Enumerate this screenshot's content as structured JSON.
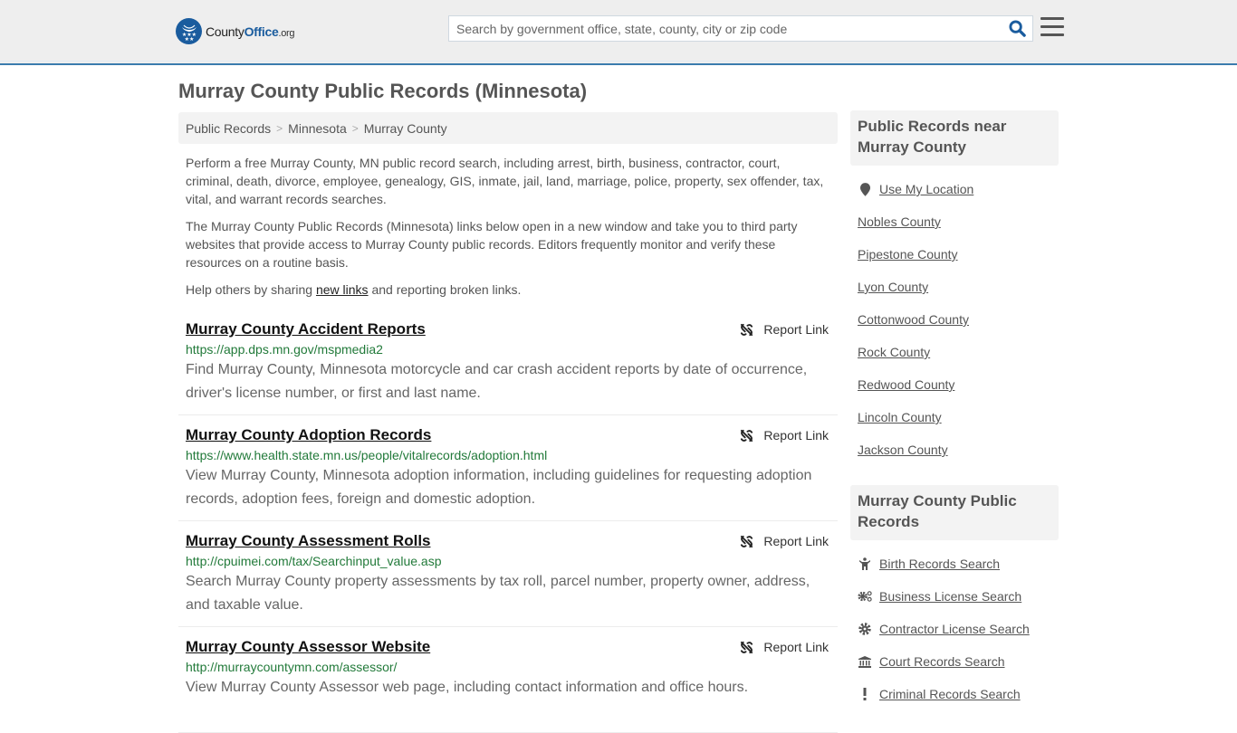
{
  "header": {
    "logo": {
      "brand_prefix": "County",
      "brand_highlight": "Office",
      "brand_suffix": ".org"
    },
    "search": {
      "placeholder": "Search by government office, state, county, city or zip code",
      "value": ""
    },
    "colors": {
      "brand_blue": "#1a5c9e",
      "accent_border": "#3a7cae"
    }
  },
  "page": {
    "title": "Murray County Public Records (Minnesota)",
    "breadcrumb": [
      "Public Records",
      "Minnesota",
      "Murray County"
    ],
    "breadcrumb_separator": ">",
    "intro": {
      "p1": "Perform a free Murray County, MN public record search, including arrest, birth, business, contractor, court, criminal, death, divorce, employee, genealogy, GIS, inmate, jail, land, marriage, police, property, sex offender, tax, vital, and warrant records searches.",
      "p2": "The Murray County Public Records (Minnesota) links below open in a new window and take you to third party websites that provide access to Murray County public records. Editors frequently monitor and verify these resources on a routine basis.",
      "p3_before": "Help others by sharing ",
      "p3_link": "new links",
      "p3_after": " and reporting broken links."
    }
  },
  "records": [
    {
      "title": "Murray County Accident Reports",
      "url": "https://app.dps.mn.gov/mspmedia2",
      "description": "Find Murray County, Minnesota motorcycle and car crash accident reports by date of occurrence, driver's license number, or first and last name.",
      "report_label": "Report Link"
    },
    {
      "title": "Murray County Adoption Records",
      "url": "https://www.health.state.mn.us/people/vitalrecords/adoption.html",
      "description": "View Murray County, Minnesota adoption information, including guidelines for requesting adoption records, adoption fees, foreign and domestic adoption.",
      "report_label": "Report Link"
    },
    {
      "title": "Murray County Assessment Rolls",
      "url": "http://cpuimei.com/tax/Searchinput_value.asp",
      "description": "Search Murray County property assessments by tax roll, parcel number, property owner, address, and taxable value.",
      "report_label": "Report Link"
    },
    {
      "title": "Murray County Assessor Website",
      "url": "http://murraycountymn.com/assessor/",
      "description": "View Murray County Assessor web page, including contact information and office hours.",
      "report_label": "Report Link"
    }
  ],
  "sidebar": {
    "nearby": {
      "heading": "Public Records near Murray County",
      "location_label": "Use My Location",
      "counties": [
        "Nobles County",
        "Pipestone County",
        "Lyon County",
        "Cottonwood County",
        "Rock County",
        "Redwood County",
        "Lincoln County",
        "Jackson County"
      ]
    },
    "county_records": {
      "heading": "Murray County Public Records",
      "items": [
        {
          "label": "Birth Records Search",
          "icon": "child-icon"
        },
        {
          "label": "Business License Search",
          "icon": "gears-icon"
        },
        {
          "label": "Contractor License Search",
          "icon": "gear-icon"
        },
        {
          "label": "Court Records Search",
          "icon": "courthouse-icon"
        },
        {
          "label": "Criminal Records Search",
          "icon": "exclamation-icon"
        }
      ]
    }
  }
}
